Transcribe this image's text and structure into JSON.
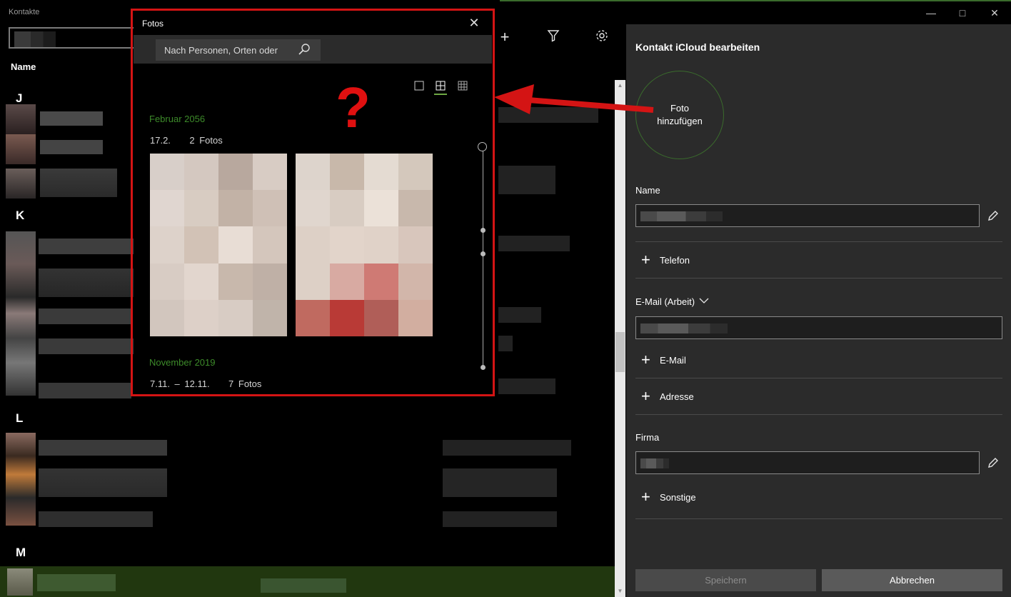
{
  "app": {
    "title": "Kontakte"
  },
  "contacts": {
    "column_header": "Name",
    "letters": [
      "J",
      "K",
      "L",
      "M"
    ]
  },
  "edit_panel": {
    "title": "Kontakt iCloud bearbeiten",
    "photo_label": "Foto hinzufügen",
    "name_label": "Name",
    "phone_add": "Telefon",
    "email_label": "E-Mail (Arbeit)",
    "email_add": "E-Mail",
    "address_add": "Adresse",
    "company_label": "Firma",
    "other_add": "Sonstige",
    "save_button": "Speichern",
    "cancel_button": "Abbrechen"
  },
  "fotos": {
    "title": "Fotos",
    "search_placeholder": "Nach Personen, Orten oder",
    "groups": [
      {
        "month": "Februar 2056",
        "date": "17.2.",
        "count": "2 Fotos"
      },
      {
        "month": "November 2019",
        "date": "7.11. – 12.11.",
        "count": "7 Fotos"
      }
    ],
    "annotation": "?"
  },
  "colors": {
    "accent_green": "#3d8b2a",
    "highlight_red": "#d41414",
    "panel_bg": "#2b2b2b",
    "selected_row": "#21370f"
  },
  "icons": [
    "close-icon",
    "minimize-icon",
    "maximize-icon",
    "add-icon",
    "filter-icon",
    "settings-icon",
    "search-icon",
    "pencil-icon",
    "plus-icon",
    "chevron-down-icon"
  ]
}
